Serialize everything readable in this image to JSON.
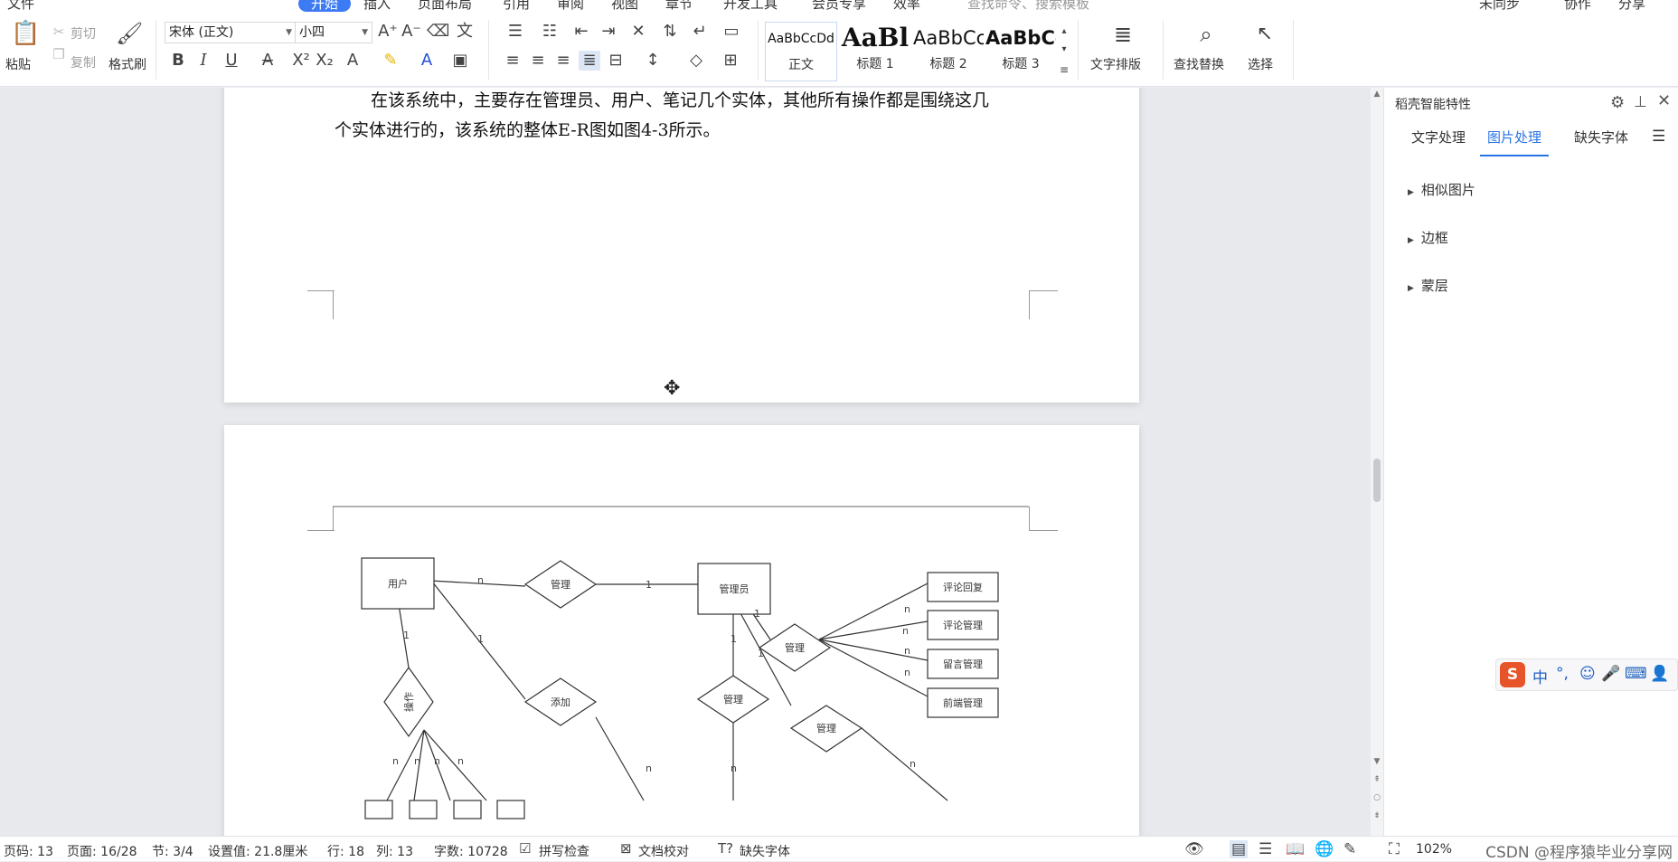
{
  "menu": {
    "file": "文件",
    "start": "开始",
    "insert": "插入",
    "layout": "页面布局",
    "references": "引用",
    "review": "审阅",
    "view": "视图",
    "chapter": "章节",
    "devtools": "开发工具",
    "member": "会员专享",
    "efficiency": "效率",
    "search_hint": "查找命令、搜索模板",
    "sync": "未同步",
    "collab": "协作",
    "share": "分享"
  },
  "ribbon": {
    "paste": "粘贴",
    "cut": "剪切",
    "copy": "复制",
    "format_painter": "格式刷",
    "font_name": "宋体 (正文)",
    "font_size": "小四",
    "styles": [
      {
        "preview": "AaBbCcDd",
        "name": "正文"
      },
      {
        "preview": "AaBl",
        "name": "标题 1"
      },
      {
        "preview": "AaBbCc",
        "name": "标题 2"
      },
      {
        "preview": "AaBbCc",
        "name": "标题 3"
      }
    ],
    "text_layout": "文字排版",
    "find_replace": "查找替换",
    "select": "选择"
  },
  "document": {
    "line1": "在该系统中，主要存在管理员、用户、笔记几个实体，其他所有操作都是围绕这几",
    "line2": "个实体进行的，该系统的整体E-R图如图4-3所示。"
  },
  "er": {
    "user": "用户",
    "admin": "管理员",
    "manage": "管理",
    "add": "添加",
    "operate": "操作",
    "comment_reply": "评论回复",
    "comment_manage": "评论管理",
    "message_manage": "留言管理",
    "frontend_manage": "前端管理",
    "card_n": "n",
    "card_1": "1"
  },
  "panel": {
    "title": "稻壳智能特性",
    "tabs": [
      "文字处理",
      "图片处理",
      "缺失字体"
    ],
    "sections": [
      "相似图片",
      "边框",
      "蒙层"
    ]
  },
  "ime": {
    "logo": "S",
    "lang": "中",
    "punct": "°,"
  },
  "status": {
    "page_no": "页码: 13",
    "page": "页面: 16/28",
    "section": "节: 3/4",
    "setting": "设置值: 21.8厘米",
    "row": "行: 18",
    "col": "列: 13",
    "words": "字数: 10728",
    "spell": "拼写检查",
    "proof": "文档校对",
    "missing_font": "缺失字体",
    "zoom": "102%",
    "watermark": "CSDN @程序猿毕业分享网"
  }
}
